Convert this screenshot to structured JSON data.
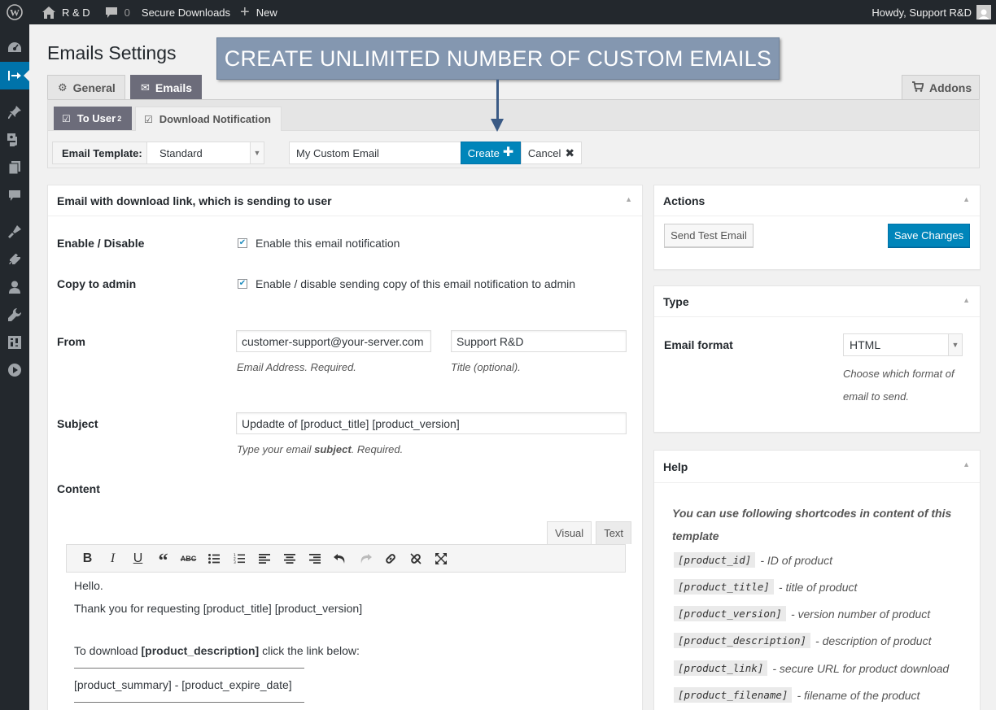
{
  "adminbar": {
    "site_name": "R & D",
    "comments_count": "0",
    "secure_downloads": "Secure Downloads",
    "new_label": "New",
    "howdy": "Howdy, Support R&D"
  },
  "page": {
    "title": "Emails Settings",
    "banner": "CREATE UNLIMITED NUMBER OF CUSTOM EMAILS"
  },
  "tabs": {
    "general": "General",
    "emails": "Emails",
    "addons": "Addons"
  },
  "subtabs": {
    "to_user": "To User",
    "to_user_count": "2",
    "download_notification": "Download Notification"
  },
  "toolbar": {
    "template_label": "Email Template:",
    "template_value": "Standard",
    "custom_email_value": "My Custom Email",
    "create_label": "Create",
    "cancel_label": "Cancel"
  },
  "main": {
    "title": "Email with download link, which is sending to user",
    "enable_label": "Enable / Disable",
    "enable_text": "Enable this email notification",
    "copy_label": "Copy to admin",
    "copy_text": "Enable / disable sending copy of this email notification to admin",
    "from_label": "From",
    "from_email": "customer-support@your-server.com",
    "from_email_desc": "Email Address. Required.",
    "from_title": "Support R&D",
    "from_title_desc": "Title (optional).",
    "subject_label": "Subject",
    "subject_value": "Updadte of [product_title] [product_version]",
    "subject_desc_pre": "Type your email ",
    "subject_desc_bold": "subject",
    "subject_desc_post": ". Required.",
    "content_label": "Content"
  },
  "editor": {
    "tab_visual": "Visual",
    "tab_text": "Text",
    "line1": "Hello.",
    "line2": "Thank you for requesting [product_title] [product_version]",
    "line3_pre": "To download ",
    "line3_bold": "[product_description]",
    "line3_post": " click the link below:",
    "line4": "[product_summary] - [product_expire_date]"
  },
  "actions": {
    "title": "Actions",
    "send_test": "Send Test Email",
    "save": "Save Changes"
  },
  "type": {
    "title": "Type",
    "format_label": "Email format",
    "format_value": "HTML",
    "format_desc": "Choose which format of email to send."
  },
  "help": {
    "title": "Help",
    "intro": "You can use following shortcodes in content of this template",
    "shortcodes": [
      {
        "code": "[product_id]",
        "desc": "- ID of product"
      },
      {
        "code": "[product_title]",
        "desc": "- title of product"
      },
      {
        "code": "[product_version]",
        "desc": "- version number of product"
      },
      {
        "code": "[product_description]",
        "desc": "- description of product"
      },
      {
        "code": "[product_link]",
        "desc": "- secure URL for product download"
      },
      {
        "code": "[product_filename]",
        "desc": "- filename of the product"
      }
    ]
  }
}
